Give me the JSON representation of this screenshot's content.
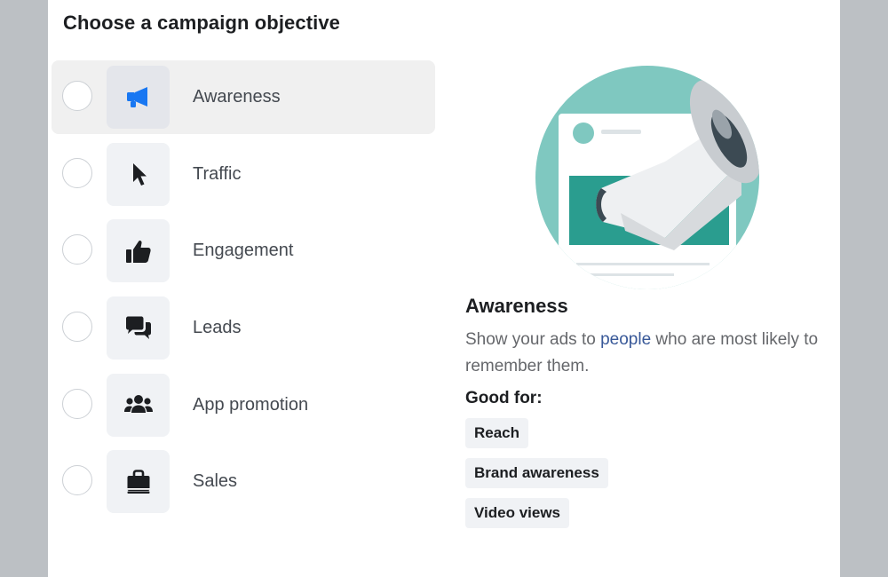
{
  "dialog": {
    "title": "Choose a campaign objective"
  },
  "objectives": [
    {
      "label": "Awareness",
      "icon": "megaphone-icon",
      "selected": true
    },
    {
      "label": "Traffic",
      "icon": "cursor-icon",
      "selected": false
    },
    {
      "label": "Engagement",
      "icon": "thumbs-up-icon",
      "selected": false
    },
    {
      "label": "Leads",
      "icon": "chat-bubbles-icon",
      "selected": false
    },
    {
      "label": "App promotion",
      "icon": "people-icon",
      "selected": false
    },
    {
      "label": "Sales",
      "icon": "shopping-bag-icon",
      "selected": false
    }
  ],
  "detail": {
    "title": "Awareness",
    "description_before": "Show your ads to ",
    "description_link": "people",
    "description_after": " who are most likely to remember them.",
    "good_for_label": "Good for:",
    "tags": [
      "Reach",
      "Brand awareness",
      "Video views"
    ],
    "illustration": "megaphone-illustration"
  },
  "colors": {
    "accent": "#1877f2",
    "icon_dark": "#1c1e21",
    "teal": "#2a9d8f",
    "teal_light": "#7fc8c0",
    "link": "#385898"
  }
}
